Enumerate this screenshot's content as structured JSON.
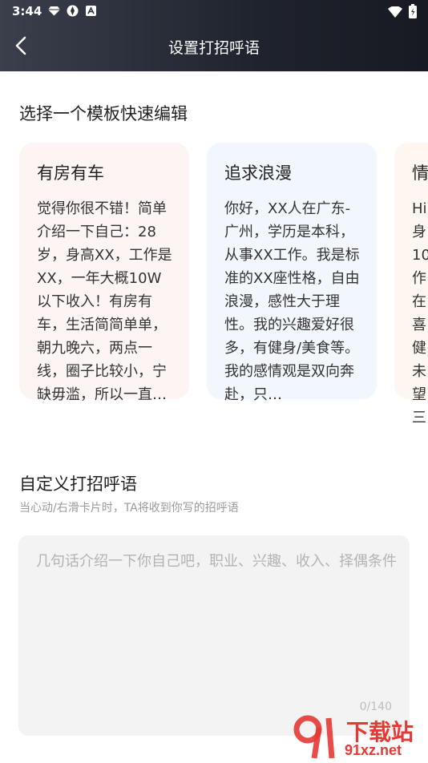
{
  "status_bar": {
    "time": "3:44",
    "icons": [
      "diamond-icon",
      "aperture-icon",
      "a-letter-icon"
    ],
    "right_icons": [
      "wifi-icon",
      "battery-icon"
    ]
  },
  "header": {
    "title": "设置打招呼语"
  },
  "templates": {
    "section_title": "选择一个模板快速编辑",
    "cards": [
      {
        "title": "有房有车",
        "body": "觉得你很不错！简单介绍一下自己：28岁，身高XX，工作是XX，一年大概10W以下收入！有房有车，生活简简单单，朝九晚六，两点一线，圈子比较小，宁缺毋滥，所以一直…"
      },
      {
        "title": "追求浪漫",
        "body": "你好，XX人在广东-广州，学历是本科，从事XX工作。我是标准的XX座性格，自由浪漫，感性大于理性。我的兴趣爱好很多，有健身/美食等。我的感情观是双向奔赴，只…"
      },
      {
        "title": "情",
        "body": "Hi\n身\n10\n作\n在\n喜\n健\n未\n望\n三"
      }
    ]
  },
  "custom": {
    "title": "自定义打招呼语",
    "subtitle": "当心动/右滑卡片时，TA将收到你写的招呼语",
    "placeholder": "几句话介绍一下你自己吧，职业、兴趣、收入、择偶条件",
    "value": "",
    "counter": "0/140"
  },
  "watermark": {
    "brand": "下载站",
    "site": "91xz.net"
  },
  "colors": {
    "header_dark": "#1f232d",
    "card1_bg": "#fdf4f4",
    "card2_bg": "#f2f6fd",
    "card3_bg": "#fdf7ef",
    "input_bg": "#f3f3f3",
    "watermark_red": "#e53935"
  }
}
